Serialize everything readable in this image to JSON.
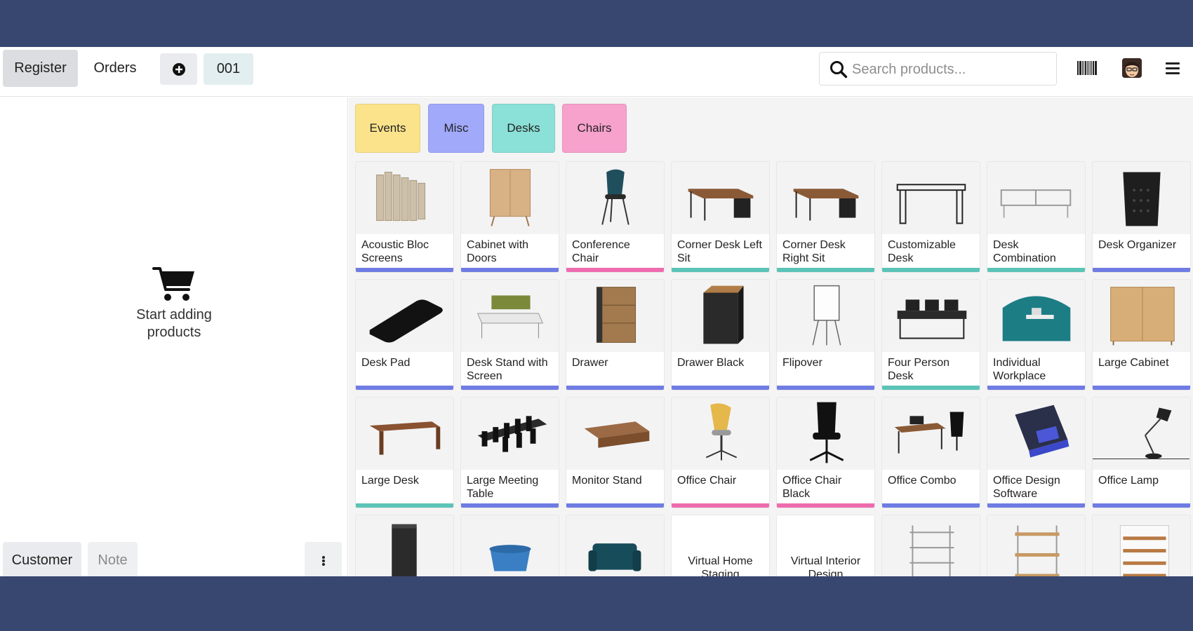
{
  "header": {
    "register_label": "Register",
    "orders_label": "Orders",
    "new_order_icon": "plus-circle-icon",
    "order_number": "001",
    "search_placeholder": "Search products...",
    "barcode_icon": "barcode-icon",
    "menu_icon": "hamburger-menu-icon"
  },
  "cart": {
    "empty_icon": "shopping-cart-icon",
    "empty_text": "Start adding products",
    "customer_label": "Customer",
    "note_label": "Note",
    "more_icon": "vertical-dots-icon"
  },
  "categories": [
    {
      "label": "Events",
      "color": "#fbe38b"
    },
    {
      "label": "Misc",
      "color": "#a1a9fb"
    },
    {
      "label": "Desks",
      "color": "#8be0d7"
    },
    {
      "label": "Chairs",
      "color": "#f7a1cd"
    }
  ],
  "colors": {
    "misc_bar": "#6f7ce3",
    "desks_bar": "#5bc4b6",
    "chairs_bar": "#ee6bae",
    "background": "#384770"
  },
  "products": [
    {
      "name": "Acoustic Bloc Screens",
      "category": "Misc",
      "icon": "screens"
    },
    {
      "name": "Cabinet with Doors",
      "category": "Misc",
      "icon": "cabinet"
    },
    {
      "name": "Conference Chair",
      "category": "Chairs",
      "icon": "chair"
    },
    {
      "name": "Corner Desk Left Sit",
      "category": "Desks",
      "icon": "corner-desk"
    },
    {
      "name": "Corner Desk Right Sit",
      "category": "Desks",
      "icon": "corner-desk"
    },
    {
      "name": "Customizable Desk",
      "category": "Desks",
      "icon": "desk"
    },
    {
      "name": "Desk Combination",
      "category": "Desks",
      "icon": "desk-combo"
    },
    {
      "name": "Desk Organizer",
      "category": "Misc",
      "icon": "organizer"
    },
    {
      "name": "Desk Pad",
      "category": "Misc",
      "icon": "desk-pad"
    },
    {
      "name": "Desk Stand with Screen",
      "category": "Misc",
      "icon": "desk-stand"
    },
    {
      "name": "Drawer",
      "category": "Misc",
      "icon": "drawer"
    },
    {
      "name": "Drawer Black",
      "category": "Misc",
      "icon": "drawer-black"
    },
    {
      "name": "Flipover",
      "category": "Misc",
      "icon": "flipover"
    },
    {
      "name": "Four Person Desk",
      "category": "Desks",
      "icon": "four-desk"
    },
    {
      "name": "Individual Workplace",
      "category": "Misc",
      "icon": "workplace"
    },
    {
      "name": "Large Cabinet",
      "category": "Misc",
      "icon": "large-cabinet"
    },
    {
      "name": "Large Desk",
      "category": "Desks",
      "icon": "large-desk"
    },
    {
      "name": "Large Meeting Table",
      "category": "Misc",
      "icon": "meeting-table"
    },
    {
      "name": "Monitor Stand",
      "category": "Misc",
      "icon": "monitor-stand"
    },
    {
      "name": "Office Chair",
      "category": "Chairs",
      "icon": "office-chair"
    },
    {
      "name": "Office Chair Black",
      "category": "Chairs",
      "icon": "office-chair-black"
    },
    {
      "name": "Office Combo",
      "category": "Misc",
      "icon": "office-combo"
    },
    {
      "name": "Office Design Software",
      "category": "Misc",
      "icon": "software-box"
    },
    {
      "name": "Office Lamp",
      "category": "Misc",
      "icon": "lamp"
    },
    {
      "name": "",
      "category": "",
      "icon": "bin"
    },
    {
      "name": "",
      "category": "",
      "icon": "basket"
    },
    {
      "name": "",
      "category": "",
      "icon": "sofa"
    },
    {
      "name": "Virtual Home Staging",
      "category": "",
      "icon": "none"
    },
    {
      "name": "Virtual Interior Design",
      "category": "",
      "icon": "none"
    },
    {
      "name": "",
      "category": "",
      "icon": "shelf"
    },
    {
      "name": "",
      "category": "",
      "icon": "shelf-wood"
    },
    {
      "name": "",
      "category": "",
      "icon": "shelf-white"
    }
  ]
}
